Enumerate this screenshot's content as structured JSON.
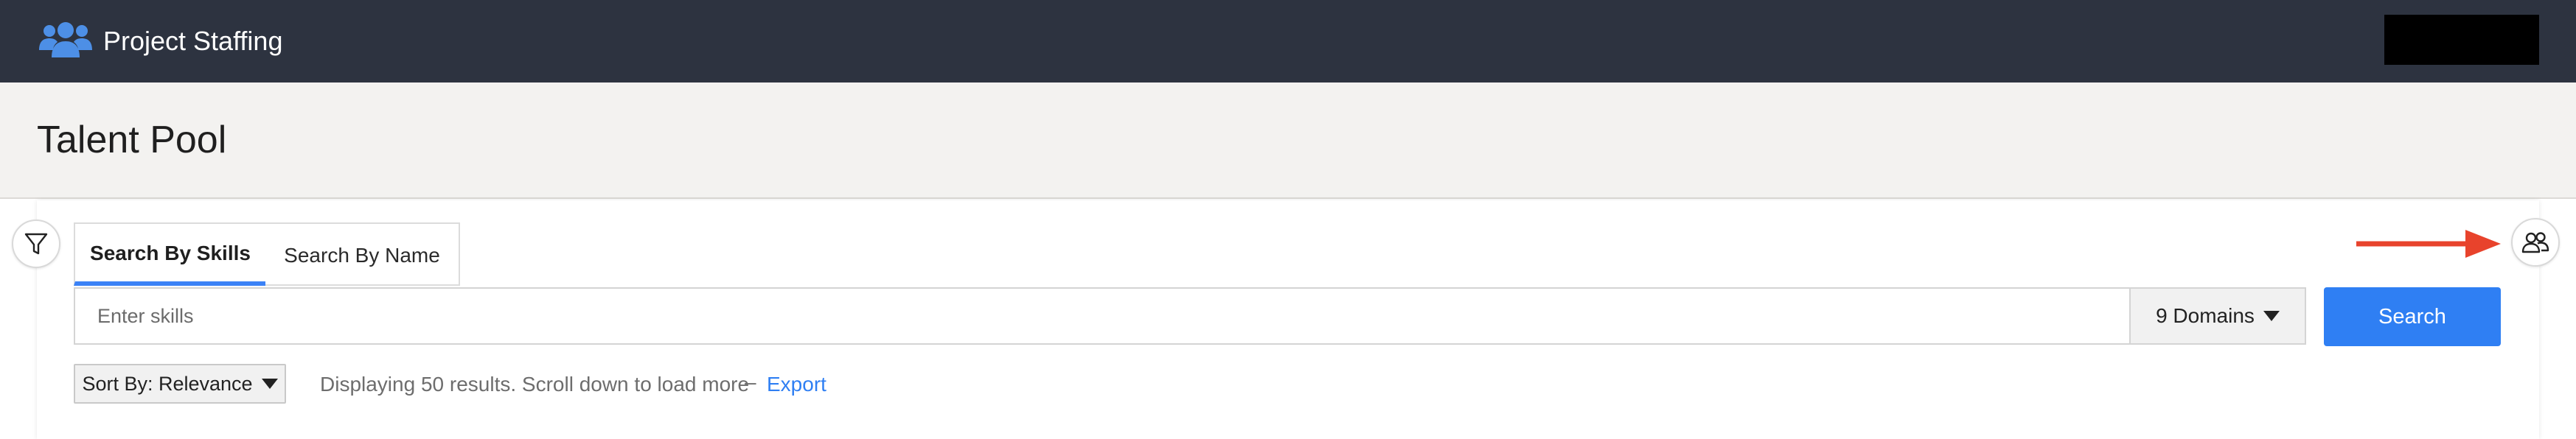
{
  "app": {
    "title": "Project Staffing",
    "brand_icon": "people-group-icon"
  },
  "page": {
    "title": "Talent Pool"
  },
  "toolbar": {
    "filter_icon": "filter-icon",
    "team_icon": "team-members-icon"
  },
  "tabs": [
    {
      "label": "Search By Skills",
      "active": true
    },
    {
      "label": "Search By Name",
      "active": false
    }
  ],
  "search": {
    "placeholder": "Enter skills",
    "value": "",
    "domains_label": "9 Domains",
    "button_label": "Search"
  },
  "results": {
    "sort_label": "Sort By: Relevance",
    "summary": "Displaying 50 results. Scroll down to load more",
    "separator": "–",
    "export_label": "Export"
  },
  "colors": {
    "header_bg": "#2d3340",
    "heading_band_bg": "#f3f2f0",
    "accent": "#2f7ff3",
    "brand_icon": "#4d8fe6",
    "annotation_arrow": "#e8432c"
  }
}
